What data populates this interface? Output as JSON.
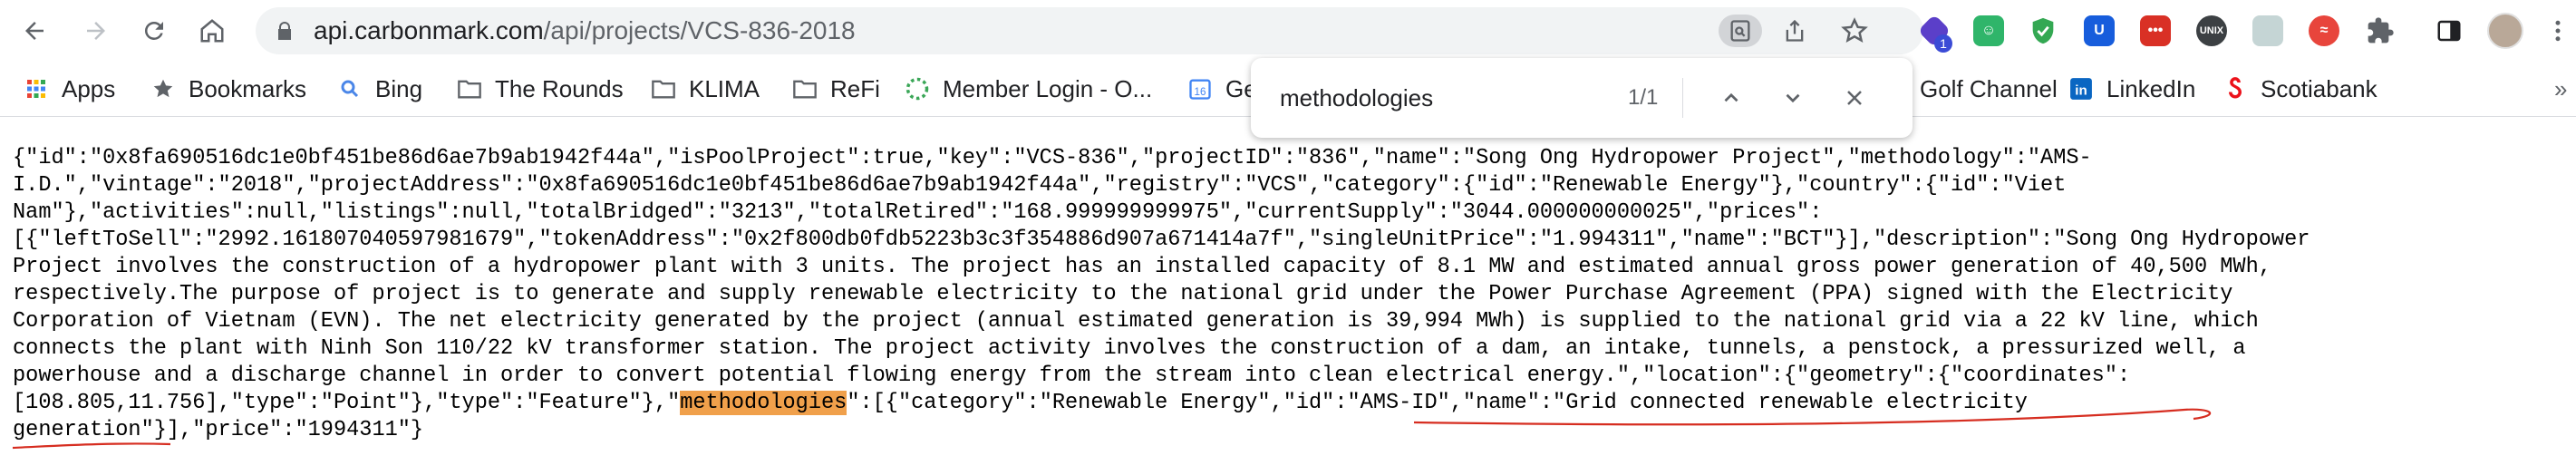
{
  "browser": {
    "url_host": "api.carbonmark.com",
    "url_path": "/api/projects/VCS-836-2018",
    "extensions": [
      "sheet-badge-extension",
      "bitwarden-like-extension",
      "shield-extension",
      "password-manager-extension",
      "red-dots-extension",
      "unix-extension",
      "image-extension",
      "redirect-extension",
      "puzzle-icon"
    ],
    "extension_badge": "1"
  },
  "bookmarks": [
    {
      "label": "Apps",
      "icon": "apps-grid-icon"
    },
    {
      "label": "Bookmarks",
      "icon": "star-icon"
    },
    {
      "label": "Bing",
      "icon": "search-icon"
    },
    {
      "label": "The Rounds",
      "icon": "folder-icon"
    },
    {
      "label": "KLIMA",
      "icon": "folder-icon"
    },
    {
      "label": "ReFi",
      "icon": "folder-icon"
    },
    {
      "label": "Member Login - O...",
      "icon": "spinner-icon"
    },
    {
      "label": "Ge",
      "icon": "calendar-icon"
    },
    {
      "label": "Golf Channel",
      "icon": "none"
    },
    {
      "label": "LinkedIn",
      "icon": "linkedin-icon"
    },
    {
      "label": "Scotiabank",
      "icon": "scotiabank-icon"
    }
  ],
  "find": {
    "query": "methodologies",
    "count": "1/1"
  },
  "content": {
    "line1": "{\"id\":\"0x8fa690516dc1e0bf451be86d6ae7b9ab1942f44a\",\"isPoolProject\":true,\"key\":\"VCS-836\",\"projectID\":\"836\",\"name\":\"Song Ong Hydropower Project\",\"methodology\":\"AMS-",
    "line2": "I.D.\",\"vintage\":\"2018\",\"projectAddress\":\"0x8fa690516dc1e0bf451be86d6ae7b9ab1942f44a\",\"registry\":\"VCS\",\"category\":{\"id\":\"Renewable Energy\"},\"country\":{\"id\":\"Viet",
    "line3": "Nam\"},\"activities\":null,\"listings\":null,\"totalBridged\":\"3213\",\"totalRetired\":\"168.999999999975\",\"currentSupply\":\"3044.000000000025\",\"prices\":",
    "line4": "[{\"leftToSell\":\"2992.161807040597981679\",\"tokenAddress\":\"0x2f800db0fdb5223b3c3f354886d907a671414a7f\",\"singleUnitPrice\":\"1.994311\",\"name\":\"BCT\"}],\"description\":\"Song Ong Hydropower",
    "line5": "Project involves the construction of a hydropower plant with 3 units. The project has an installed capacity of 8.1 MW and estimated annual gross power generation of 40,500 MWh,",
    "line6": "respectively.The purpose of project is to generate and supply renewable electricity to the national grid under the Power Purchase Agreement (PPA) signed with the Electricity",
    "line7": "Corporation of Vietnam (EVN). The net electricity generated by the project (annual estimated generation is 39,994 MWh) is supplied to the national grid via a 22 kV line, which",
    "line8": "connects the plant with Ninh Son 110/22 kV transformer station. The project activity involves the construction of a dam, an intake, tunnels, a penstock, a pressurized well, a",
    "line9": "powerhouse and a discharge channel in order to convert potential flowing energy from the stream into clean electrical energy.\",\"location\":{\"geometry\":{\"coordinates\":",
    "line10_pre": "[108.805,11.756],\"type\":\"Point\"},\"type\":\"Feature\"},\"",
    "line10_hl": "methodologies",
    "line10_post": "\":[{\"category\":\"Renewable Energy\",\"id\":\"AMS-ID\",\"name\":\"Grid connected renewable electricity",
    "line11": "generation\"}],\"price\":\"1994311\"}"
  }
}
